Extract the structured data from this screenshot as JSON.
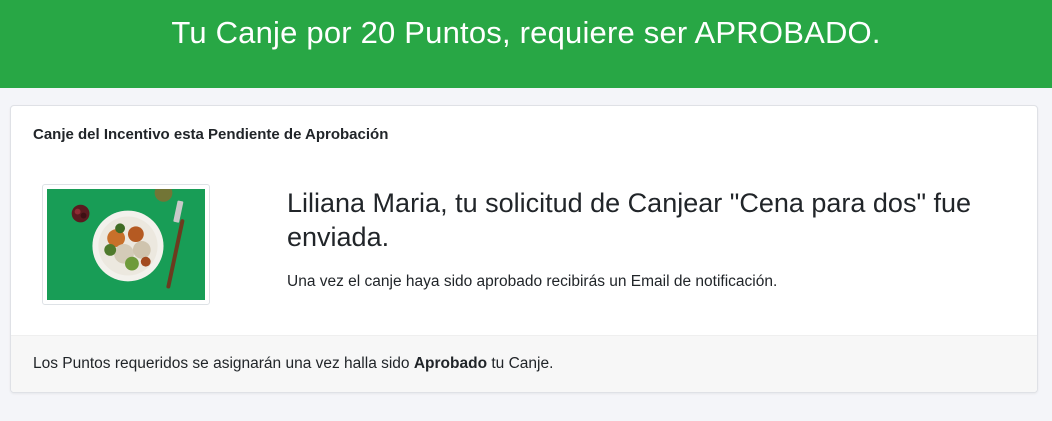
{
  "banner": {
    "title": "Tu Canje por 20 Puntos, requiere ser APROBADO."
  },
  "card": {
    "header": "Canje del Incentivo esta Pendiente de Aprobación",
    "title": "Liliana Maria, tu solicitud de Canjear \"Cena para dos\" fue enviada.",
    "subtitle": "Una vez el canje haya sido aprobado recibirás un Email de notificación.",
    "footer": {
      "before": "Los Puntos requeridos se asignarán una vez halla sido ",
      "bold": "Aprobado",
      "after": " tu Canje."
    }
  },
  "image": {
    "icon": "dinner-plate-image"
  },
  "colors": {
    "banner": "#28a745",
    "image_background": "#1aa35a"
  }
}
